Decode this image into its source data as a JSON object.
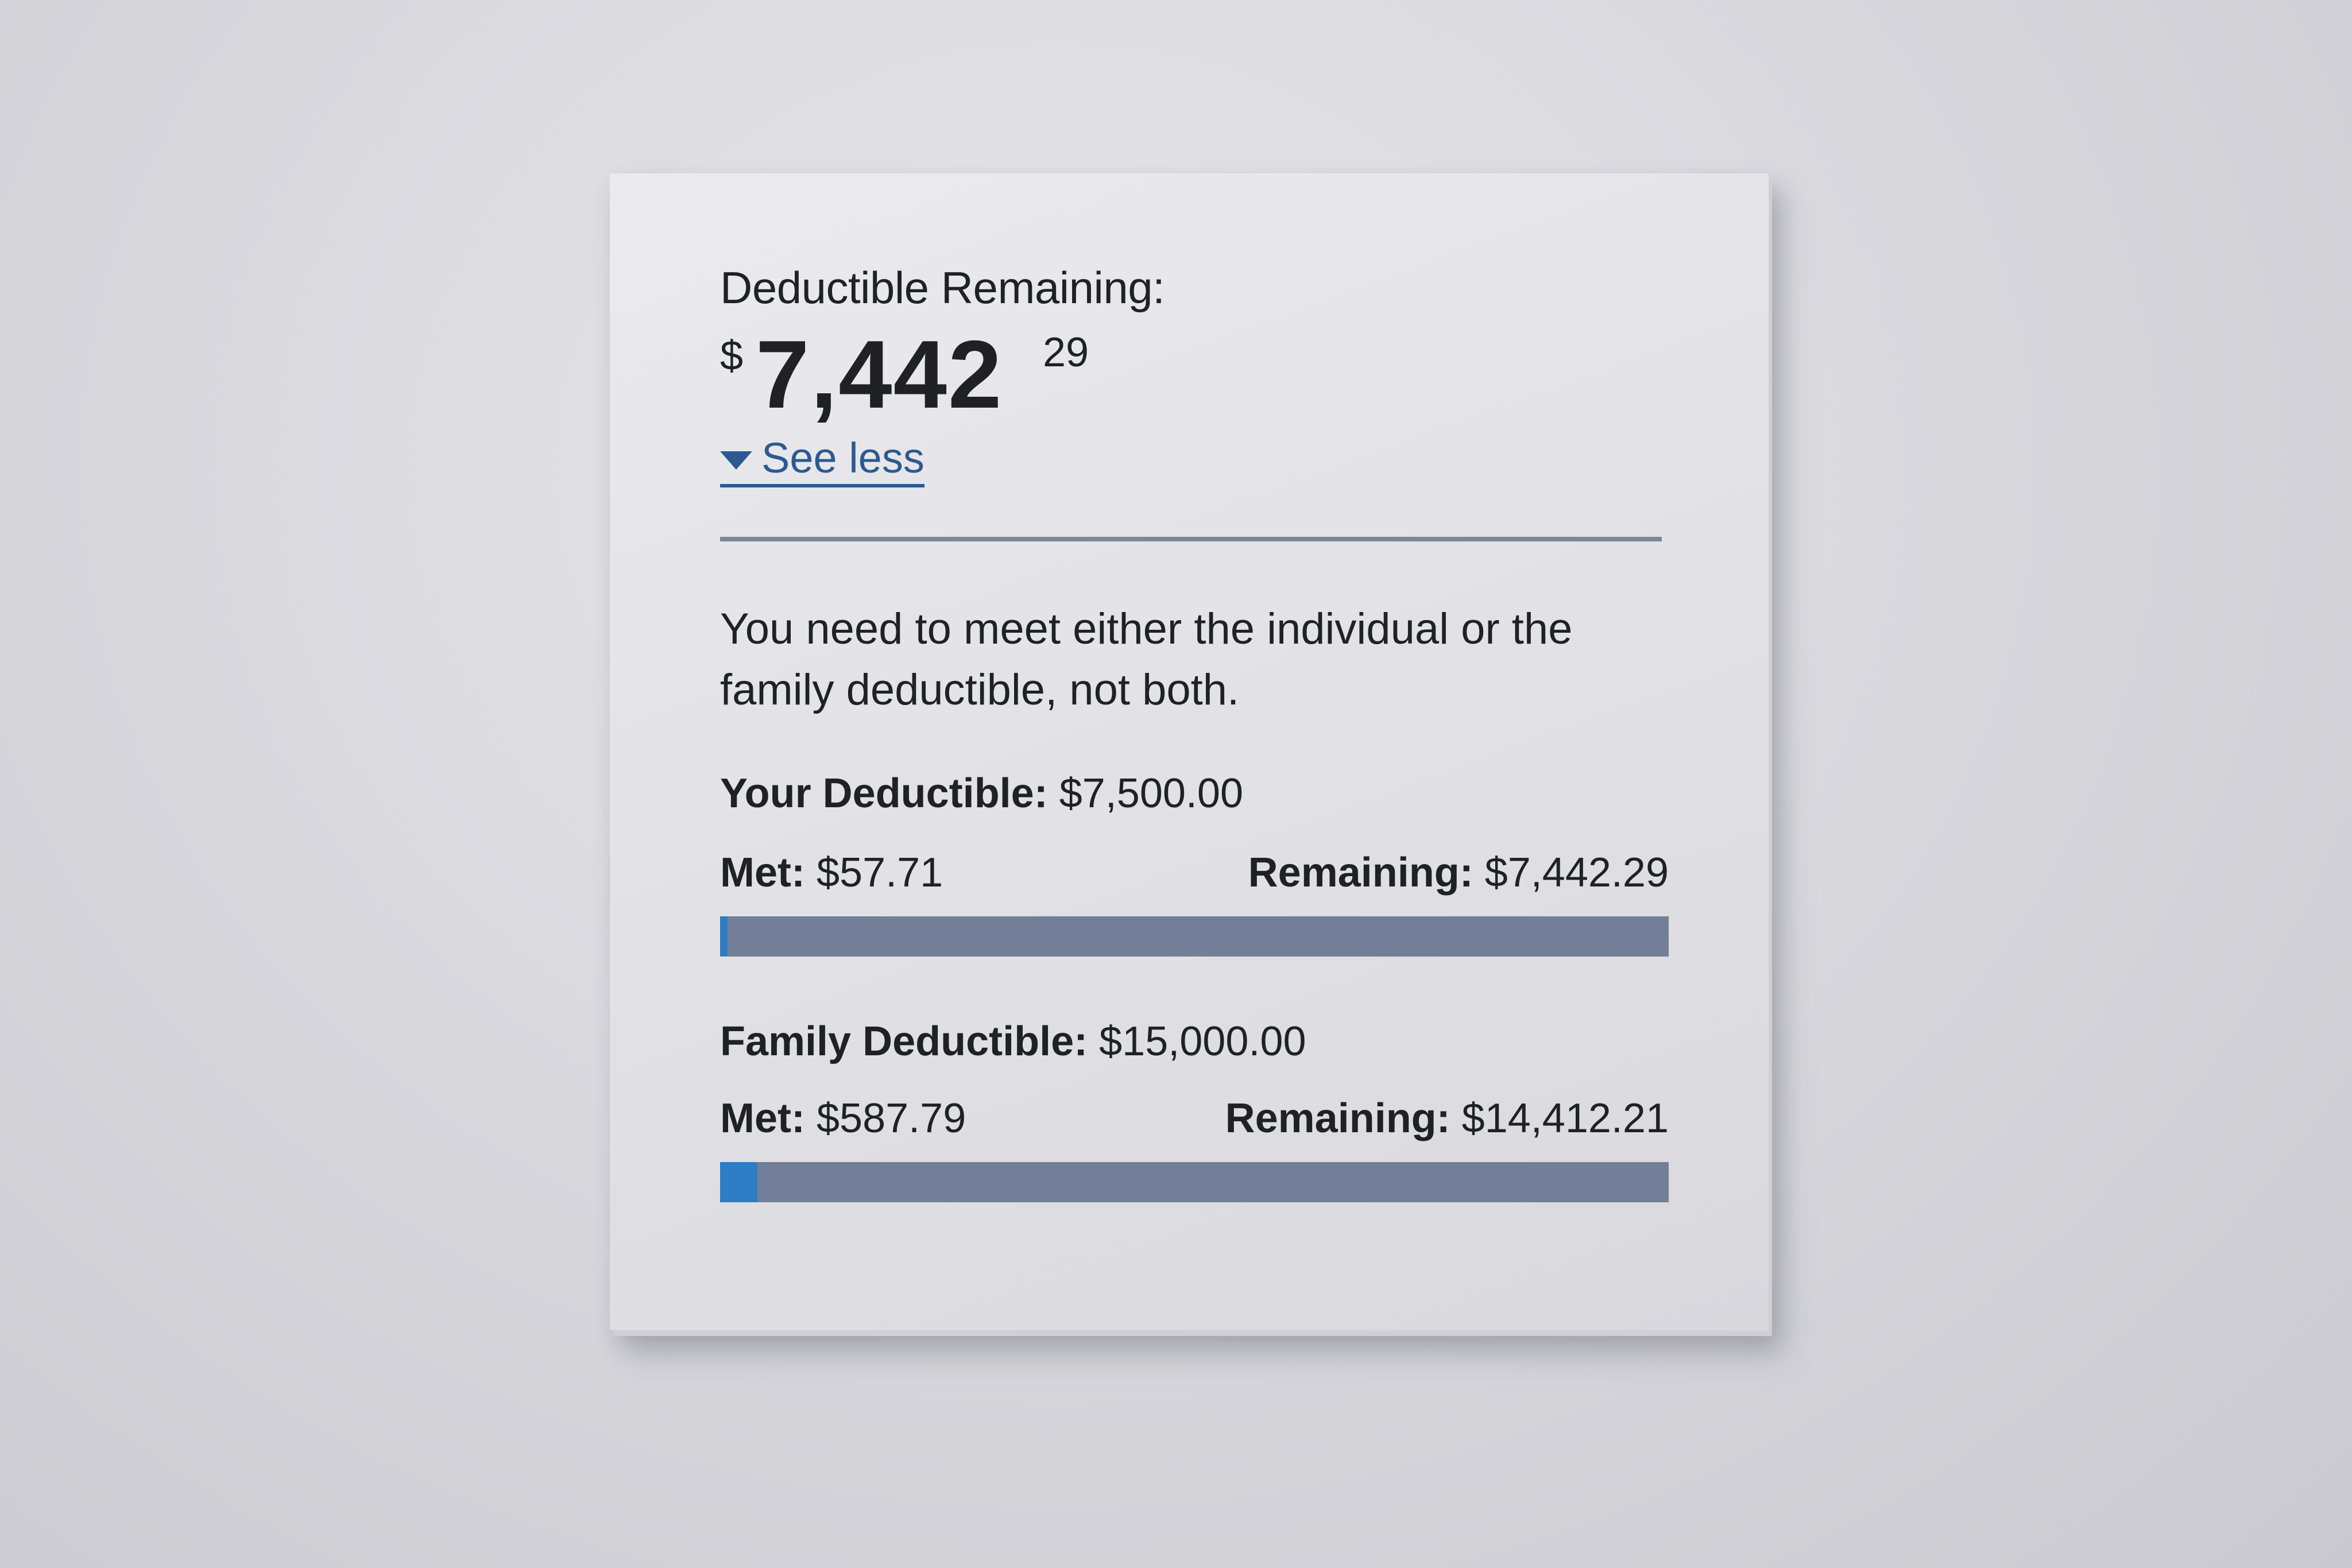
{
  "summary": {
    "heading": "Deductible Remaining:",
    "amount_currency": "$",
    "amount_whole": "7,442",
    "amount_cents": "29",
    "toggle_label": "See less"
  },
  "note": "You need to meet either the individual or the family deductible, not both.",
  "individual": {
    "title_label": "Your Deductible:",
    "title_value": " $7,500.00",
    "met_label": "Met:",
    "met_value": " $57.71",
    "remaining_label": "Remaining:",
    "remaining_value": " $7,442.29",
    "progress_fraction": 0.0077
  },
  "family": {
    "title_label": "Family Deductible:",
    "title_value": " $15,000.00",
    "met_label": "Met:",
    "met_value": " $587.79",
    "remaining_label": "Remaining:",
    "remaining_value": " $14,412.21",
    "progress_fraction": 0.0392
  },
  "colors": {
    "link": "#2c5a90",
    "bar_track": "#737e98",
    "bar_fill": "#2e7cc4"
  },
  "icons": {
    "toggle": "caret-down-icon"
  }
}
